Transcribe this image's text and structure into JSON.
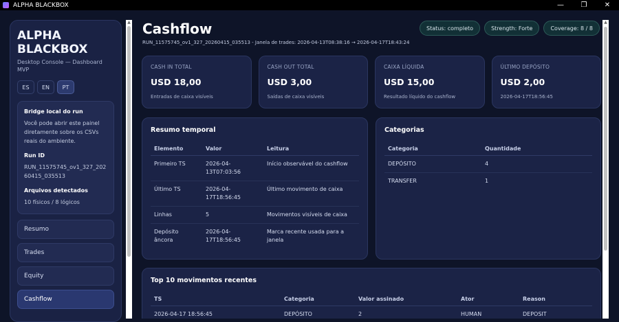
{
  "window": {
    "title": "ALPHA BLACKBOX",
    "controls": [
      "—",
      "❐",
      "✕"
    ]
  },
  "sidebar": {
    "brand": "ALPHA BLACKBOX",
    "subtitle": "Desktop Console — Dashboard MVP",
    "languages": [
      "ES",
      "EN",
      "PT"
    ],
    "active_language": "PT",
    "bridge_title": "Bridge local do run",
    "bridge_text": "Você pode abrir este painel diretamente sobre os CSVs reais do ambiente.",
    "run_id_label": "Run ID",
    "run_id_value": "RUN_11575745_ov1_327_20260415_035513",
    "files_label": "Arquivos detectados",
    "files_value": "10 físicos / 8 lógicos",
    "nav": [
      "Resumo",
      "Trades",
      "Equity",
      "Cashflow"
    ],
    "active_nav": "Cashflow"
  },
  "header": {
    "title": "Cashflow",
    "run_line": "RUN_11575745_ov1_327_20260415_035513 - Janela de trades: 2026-04-13T08:38:16 → 2026-04-17T18:43:24",
    "badges": [
      "Status: completo",
      "Strength: Forte",
      "Coverage: 8 / 8"
    ]
  },
  "kpis": [
    {
      "label": "CASH IN TOTAL",
      "value": "USD 18,00",
      "note": "Entradas de caixa visíveis"
    },
    {
      "label": "CASH OUT TOTAL",
      "value": "USD 3,00",
      "note": "Saídas de caixa visíveis"
    },
    {
      "label": "CAIXA LÍQUIDA",
      "value": "USD 15,00",
      "note": "Resultado líquido do cashflow"
    },
    {
      "label": "ÚLTIMO DEPÓSITO",
      "value": "USD 2,00",
      "note": "2026-04-17T18:56:45"
    }
  ],
  "resumo": {
    "title": "Resumo temporal",
    "columns": [
      "Elemento",
      "Valor",
      "Leitura"
    ],
    "rows": [
      [
        "Primeiro TS",
        "2026-04-13T07:03:56",
        "Início observável do cashflow"
      ],
      [
        "Último TS",
        "2026-04-17T18:56:45",
        "Último movimento de caixa"
      ],
      [
        "Linhas",
        "5",
        "Movimentos visíveis de caixa"
      ],
      [
        "Depósito âncora",
        "2026-04-17T18:56:45",
        "Marca recente usada para a janela"
      ]
    ]
  },
  "categorias": {
    "title": "Categorias",
    "columns": [
      "Categoria",
      "Quantidade"
    ],
    "rows": [
      [
        "DEPÓSITO",
        "4"
      ],
      [
        "TRANSFER",
        "1"
      ]
    ]
  },
  "recentes": {
    "title": "Top 10 movimentos recentes",
    "columns": [
      "TS",
      "Categoria",
      "Valor assinado",
      "Ator",
      "Reason"
    ],
    "rows": [
      [
        "2026-04-17 18:56:45",
        "DEPÓSITO",
        "2",
        "HUMAN",
        "DEPOSIT"
      ]
    ]
  }
}
